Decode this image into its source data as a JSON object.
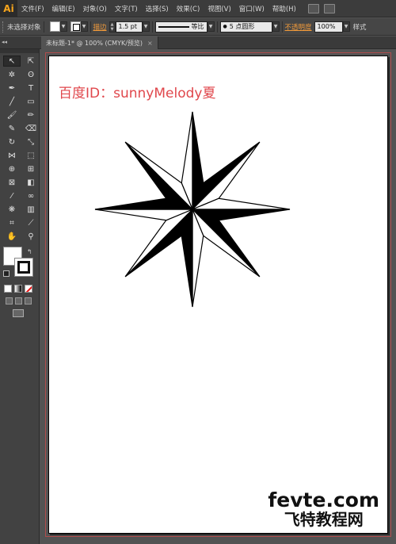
{
  "app": {
    "logo": "Ai"
  },
  "menu": {
    "items": [
      "文件(F)",
      "编辑(E)",
      "对象(O)",
      "文字(T)",
      "选择(S)",
      "效果(C)",
      "视图(V)",
      "窗口(W)",
      "帮助(H)"
    ],
    "icons": [
      "bridge-icon",
      "arrange-documents-icon"
    ]
  },
  "control_bar": {
    "selection_status": "未选择对象",
    "stroke_label": "描边",
    "stroke_weight": "1.5 pt",
    "profile_label": "等比",
    "brush_label": "5 点圆形",
    "opacity_label": "不透明度",
    "opacity_value": "100%",
    "style_label": "样式"
  },
  "document_tab": {
    "title": "未标题-1* @ 100% (CMYK/预览)",
    "close": "×"
  },
  "tools": {
    "items": [
      {
        "name": "selection-tool",
        "glyph": "↖"
      },
      {
        "name": "direct-selection-tool",
        "glyph": "⇱"
      },
      {
        "name": "magic-wand-tool",
        "glyph": "✲"
      },
      {
        "name": "lasso-tool",
        "glyph": "ʘ"
      },
      {
        "name": "pen-tool",
        "glyph": "✒"
      },
      {
        "name": "type-tool",
        "glyph": "T"
      },
      {
        "name": "line-segment-tool",
        "glyph": "╱"
      },
      {
        "name": "rectangle-tool",
        "glyph": "▭"
      },
      {
        "name": "paintbrush-tool",
        "glyph": "🖌"
      },
      {
        "name": "pencil-tool",
        "glyph": "✏"
      },
      {
        "name": "blob-brush-tool",
        "glyph": "✎"
      },
      {
        "name": "eraser-tool",
        "glyph": "⌫"
      },
      {
        "name": "rotate-tool",
        "glyph": "↻"
      },
      {
        "name": "scale-tool",
        "glyph": "⤡"
      },
      {
        "name": "width-tool",
        "glyph": "⋈"
      },
      {
        "name": "free-transform-tool",
        "glyph": "⬚"
      },
      {
        "name": "shape-builder-tool",
        "glyph": "⊕"
      },
      {
        "name": "perspective-grid-tool",
        "glyph": "⊞"
      },
      {
        "name": "mesh-tool",
        "glyph": "⊠"
      },
      {
        "name": "gradient-tool",
        "glyph": "◧"
      },
      {
        "name": "eyedropper-tool",
        "glyph": "⁄"
      },
      {
        "name": "blend-tool",
        "glyph": "∞"
      },
      {
        "name": "symbol-sprayer-tool",
        "glyph": "❋"
      },
      {
        "name": "column-graph-tool",
        "glyph": "▥"
      },
      {
        "name": "artboard-tool",
        "glyph": "⌗"
      },
      {
        "name": "slice-tool",
        "glyph": "⟋"
      },
      {
        "name": "hand-tool",
        "glyph": "✋"
      },
      {
        "name": "zoom-tool",
        "glyph": "⚲"
      }
    ]
  },
  "artboard_content": {
    "watermark": "百度ID：sunnyMelody夏",
    "site_en": "fevte.com",
    "site_cn": "飞特教程网"
  },
  "colors": {
    "menu_bg": "#3c3c3c",
    "panel_bg": "#424242",
    "canvas_bg": "#535353",
    "watermark_red": "#e0474c",
    "accent_orange": "#f19a3a",
    "star_black": "#000000",
    "star_white": "#ffffff"
  }
}
